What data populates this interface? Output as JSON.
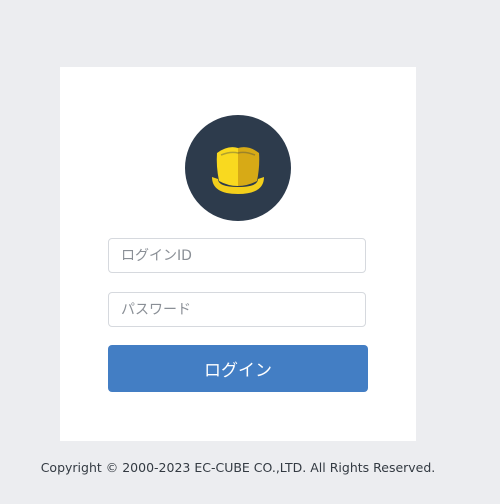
{
  "login": {
    "logo_icon": "ec-cube-hat-logo-icon",
    "id_placeholder": "ログインID",
    "password_placeholder": "パスワード",
    "submit_label": "ログイン"
  },
  "footer": {
    "copyright": "Copyright © 2000-2023 EC-CUBE CO.,LTD. All Rights Reserved."
  },
  "colors": {
    "background": "#ecedf0",
    "card": "#ffffff",
    "logo_circle": "#2d3b4c",
    "logo_yellow": "#f6d21f",
    "button": "#437ec4"
  }
}
